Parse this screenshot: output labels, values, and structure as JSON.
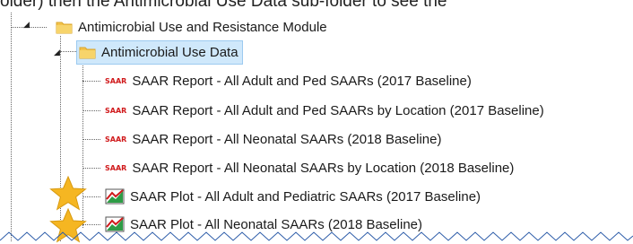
{
  "caption": "older) then the Antimicrobial Use Data sub-folder to see the",
  "tree": {
    "module_folder": "Antimicrobial Use and Resistance Module",
    "subfolder": "Antimicrobial Use Data",
    "report_tag": "SAAR",
    "items": [
      {
        "kind": "report",
        "label": "SAAR Report - All Adult and Ped SAARs (2017 Baseline)"
      },
      {
        "kind": "report",
        "label": "SAAR Report - All Adult and Ped SAARs by Location (2017 Baseline)"
      },
      {
        "kind": "report",
        "label": "SAAR Report - All Neonatal SAARs (2018 Baseline)"
      },
      {
        "kind": "report",
        "label": "SAAR Report - All Neonatal SAARs by Location (2018 Baseline)"
      },
      {
        "kind": "plot",
        "label": "SAAR Plot - All Adult and Pediatric SAARs (2017 Baseline)"
      },
      {
        "kind": "plot",
        "label": "SAAR Plot - All Neonatal SAARs (2018 Baseline)"
      }
    ]
  },
  "icons": {
    "folder": "folder-icon",
    "report": "saar-report-icon",
    "plot": "line-chart-icon",
    "annotation": "star-icon",
    "expander": "expand-arrow-icon"
  },
  "colors": {
    "folder": "#f3c34a",
    "selection": "#cfe8fb",
    "report_tag": "#d0191b",
    "star": "#f5b622",
    "plot_line": "#d0191b",
    "plot_green": "#2e9c46"
  }
}
